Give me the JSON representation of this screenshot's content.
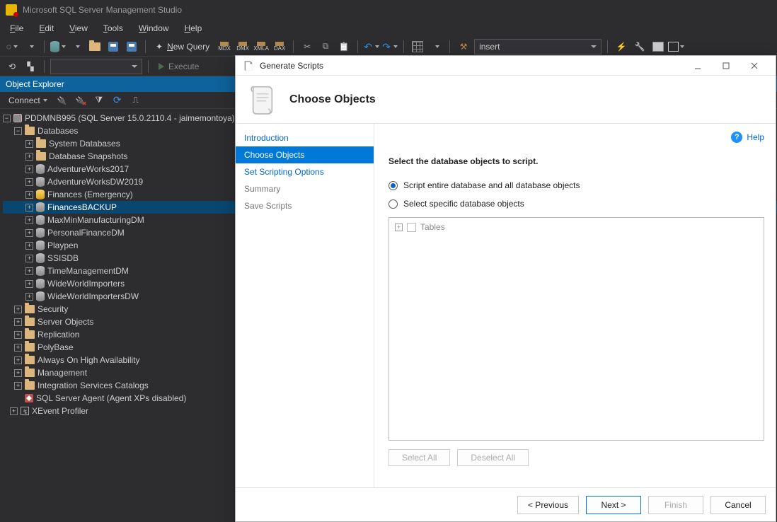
{
  "app": {
    "title": "Microsoft SQL Server Management Studio"
  },
  "menu": {
    "file": "File",
    "edit": "Edit",
    "view": "View",
    "tools": "Tools",
    "window": "Window",
    "help": "Help"
  },
  "toolbar": {
    "new_query": "New Query",
    "execute": "Execute",
    "search_value": "insert",
    "mdx_labels": [
      "MDX",
      "DMX",
      "XMLA",
      "DAX"
    ]
  },
  "panel": {
    "title": "Object Explorer",
    "connect": "Connect"
  },
  "tree": {
    "root": "PDDMNB995 (SQL Server 15.0.2110.4 - jaimemontoya)",
    "databases": "Databases",
    "db_children": [
      {
        "label": "System Databases",
        "type": "folder"
      },
      {
        "label": "Database Snapshots",
        "type": "folder"
      },
      {
        "label": "AdventureWorks2017",
        "type": "db"
      },
      {
        "label": "AdventureWorksDW2019",
        "type": "db"
      },
      {
        "label": "Finances (Emergency)",
        "type": "emerg"
      },
      {
        "label": "FinancesBACKUP",
        "type": "db",
        "selected": true
      },
      {
        "label": "MaxMinManufacturingDM",
        "type": "db"
      },
      {
        "label": "PersonalFinanceDM",
        "type": "db"
      },
      {
        "label": "Playpen",
        "type": "db"
      },
      {
        "label": "SSISDB",
        "type": "db"
      },
      {
        "label": "TimeManagementDM",
        "type": "db"
      },
      {
        "label": "WideWorldImporters",
        "type": "db"
      },
      {
        "label": "WideWorldImportersDW",
        "type": "db"
      }
    ],
    "siblings": [
      "Security",
      "Server Objects",
      "Replication",
      "PolyBase",
      "Always On High Availability",
      "Management",
      "Integration Services Catalogs"
    ],
    "agent": "SQL Server Agent (Agent XPs disabled)",
    "xevent": "XEvent Profiler"
  },
  "dialog": {
    "window_title": "Generate Scripts",
    "heading": "Choose Objects",
    "steps": {
      "intro": "Introduction",
      "choose": "Choose Objects",
      "scripting": "Set Scripting Options",
      "summary": "Summary",
      "save": "Save Scripts"
    },
    "help": "Help",
    "prompt": "Select the database objects to script.",
    "radio1": "Script entire database and all database objects",
    "radio2": "Select specific database objects",
    "tree_item": "Tables",
    "select_all": "Select All",
    "deselect_all": "Deselect All",
    "btn_prev": "< Previous",
    "btn_next": "Next >",
    "btn_finish": "Finish",
    "btn_cancel": "Cancel"
  }
}
